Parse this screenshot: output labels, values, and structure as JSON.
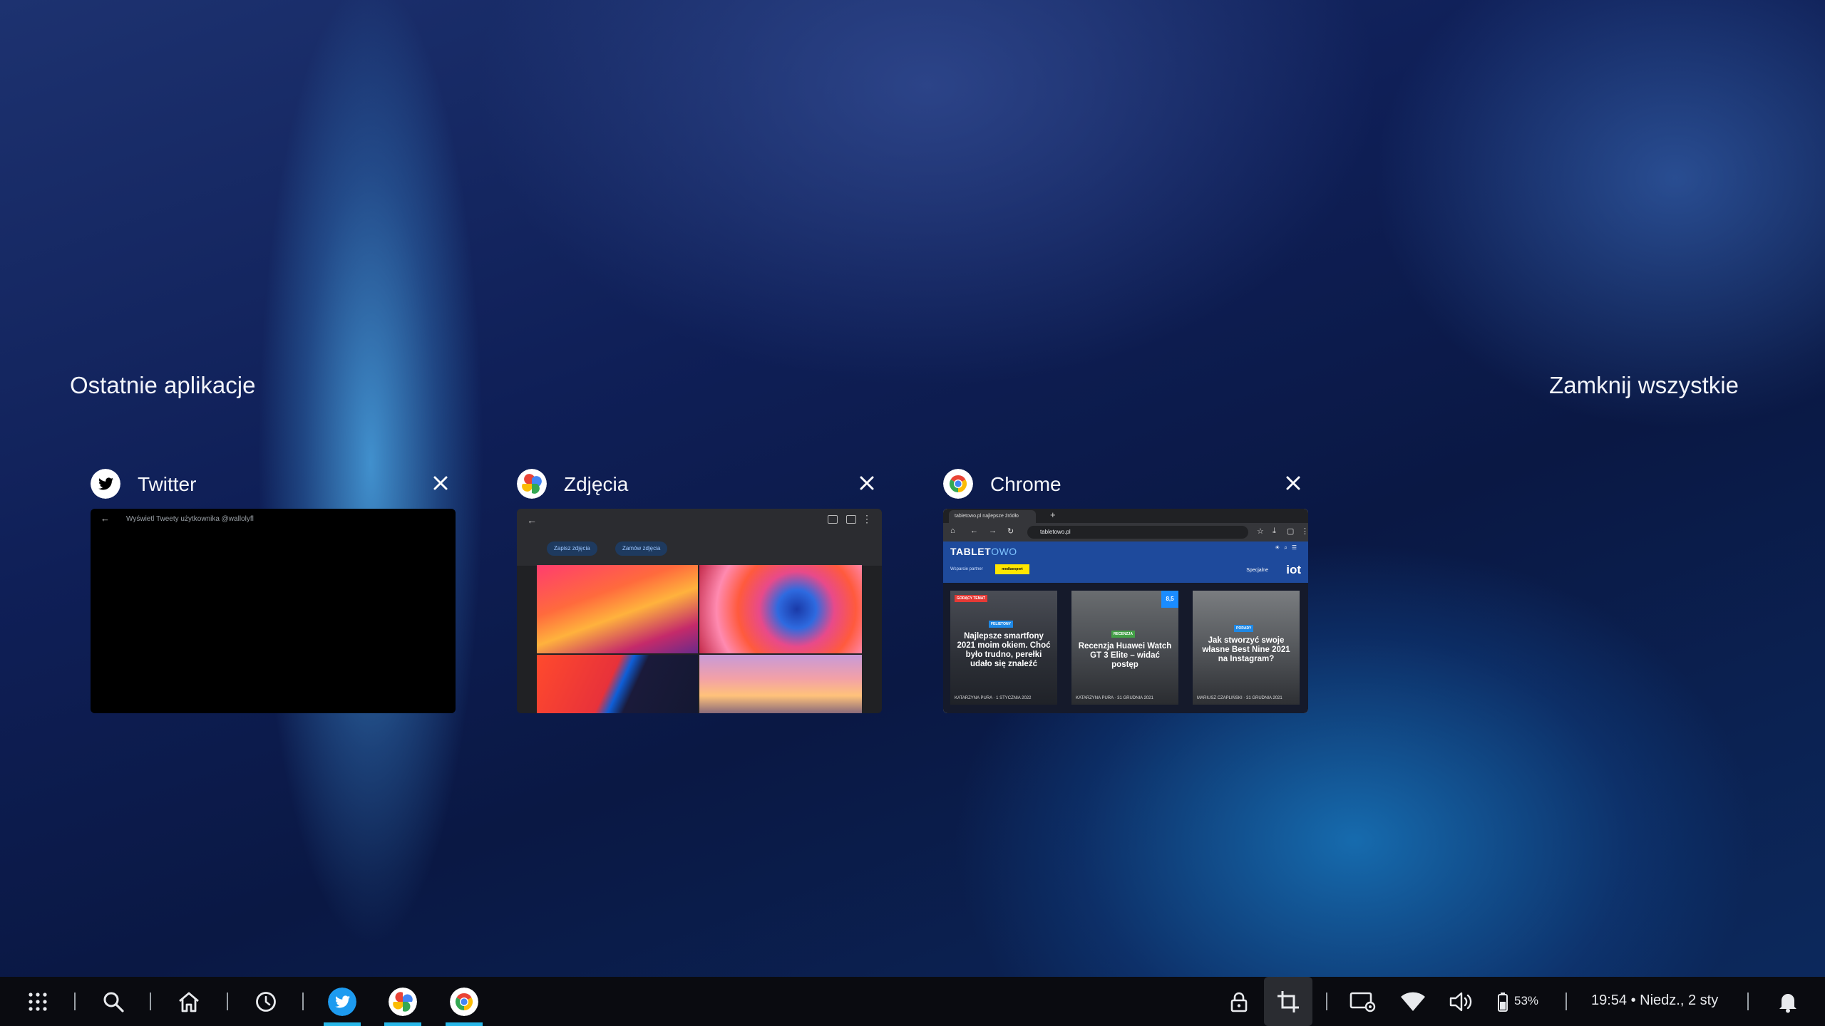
{
  "overview": {
    "title": "Ostatnie aplikacje",
    "close_all": "Zamknij wszystkie"
  },
  "cards": [
    {
      "name": "Twitter",
      "icon": "twitter-icon",
      "preview_text": "Wyświetl Tweety użytkownika @wallolyfl"
    },
    {
      "name": "Zdjęcia",
      "icon": "google-photos-icon",
      "chip_save": "Zapisz zdjęcia",
      "chip_order": "Zamów zdjęcia"
    },
    {
      "name": "Chrome",
      "icon": "chrome-icon",
      "tab_title": "tabletowo.pl najlepsze źródło",
      "url": "tabletowo.pl",
      "site": {
        "logo_main": "TABLET",
        "logo_light": "OWO",
        "partner_label": "Wsparcie partner",
        "partner_name": "mediaexpert",
        "specjalne": "Specjalne",
        "iot": "iot",
        "articles": [
          {
            "badge_top": "GORĄCY TEMAT",
            "badge": "FELIETONY",
            "title": "Najlepsze smartfony 2021 moim okiem. Choć było trudno, perełki udało się znaleźć",
            "meta": "KATARZYNA PURA · 1 STYCZNIA 2022"
          },
          {
            "badge": "RECENZJA",
            "score": "8,5",
            "title": "Recenzja Huawei Watch GT 3 Elite – widać postęp",
            "meta": "KATARZYNA PURA · 31 GRUDNIA 2021"
          },
          {
            "badge": "PORADY",
            "title": "Jak stworzyć swoje własne Best Nine 2021 na Instagram?",
            "meta": "MARIUSZ CZAPLIŃSKI · 31 GRUDNIA 2021"
          }
        ]
      }
    }
  ],
  "taskbar": {
    "battery_pct": "53%",
    "clock": "19:54 • Niedz., 2 sty"
  },
  "colors": {
    "accent_underline": "#28b7e8",
    "twitter_blue": "#1d9bf0"
  }
}
